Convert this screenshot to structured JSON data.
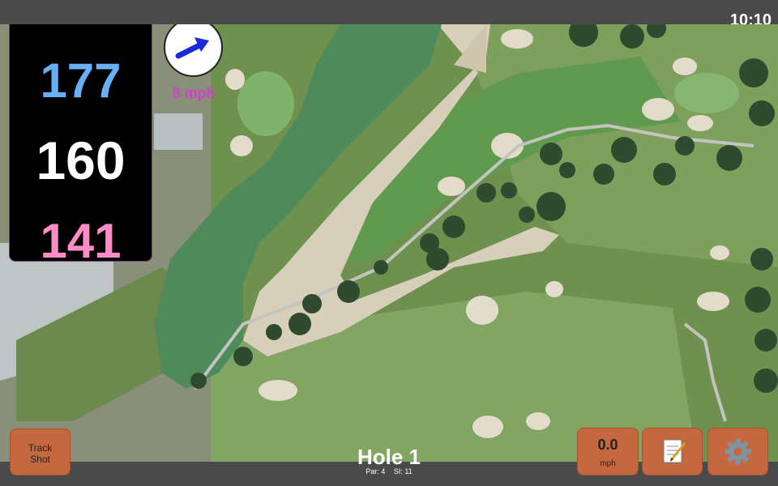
{
  "status_bar": {
    "time": "10:10"
  },
  "distances": {
    "back": "177",
    "middle": "160",
    "front": "141"
  },
  "wind": {
    "speed": "8 mph",
    "icon": "wind-direction-arrow-icon"
  },
  "hole": {
    "title": "Hole 1",
    "par": "Par: 4",
    "stroke_index": "SI: 11"
  },
  "buttons": {
    "track_shot_line1": "Track",
    "track_shot_line2": "Shot",
    "speed_value": "0.0",
    "speed_unit": "mph",
    "notes_icon": "notepad-icon",
    "settings_icon": "gear-icon"
  },
  "colors": {
    "back": "#67b0f3",
    "middle": "#ffffff",
    "front": "#ff8cc6",
    "wind_text": "#d23fcf",
    "button": "#c5673f"
  }
}
